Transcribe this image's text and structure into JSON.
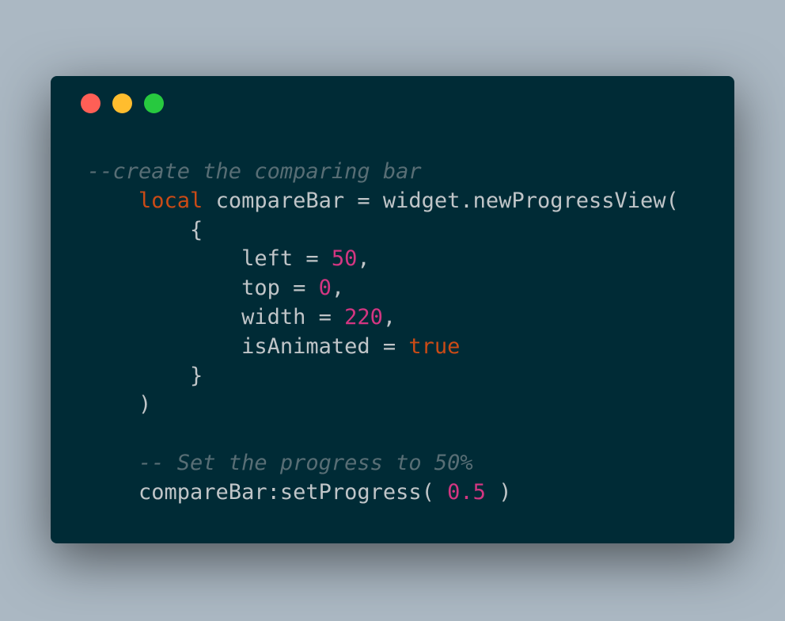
{
  "colors": {
    "background": "#abb8c3",
    "window": "#002b36",
    "text": "#c0c5c8",
    "comment": "#586e75",
    "keyword": "#cb4b16",
    "number": "#d33682",
    "close": "#ff5f56",
    "minimize": "#ffbd2e",
    "maximize": "#27c93f"
  },
  "window_controls": [
    {
      "name": "close-dot",
      "color": "#ff5f56"
    },
    {
      "name": "minimize-dot",
      "color": "#ffbd2e"
    },
    {
      "name": "maximize-dot",
      "color": "#27c93f"
    }
  ],
  "code_lines": [
    [
      {
        "t": "--create the comparing bar",
        "k": "comment"
      }
    ],
    [
      {
        "t": "    ",
        "k": "plain"
      },
      {
        "t": "local",
        "k": "keyword"
      },
      {
        "t": " compareBar = widget.newProgressView(",
        "k": "plain"
      }
    ],
    [
      {
        "t": "        {",
        "k": "plain"
      }
    ],
    [
      {
        "t": "            left = ",
        "k": "plain"
      },
      {
        "t": "50",
        "k": "number"
      },
      {
        "t": ",",
        "k": "plain"
      }
    ],
    [
      {
        "t": "            top = ",
        "k": "plain"
      },
      {
        "t": "0",
        "k": "number"
      },
      {
        "t": ",",
        "k": "plain"
      }
    ],
    [
      {
        "t": "            width = ",
        "k": "plain"
      },
      {
        "t": "220",
        "k": "number"
      },
      {
        "t": ",",
        "k": "plain"
      }
    ],
    [
      {
        "t": "            isAnimated = ",
        "k": "plain"
      },
      {
        "t": "true",
        "k": "keyword"
      }
    ],
    [
      {
        "t": "        }",
        "k": "plain"
      }
    ],
    [
      {
        "t": "    )",
        "k": "plain"
      }
    ],
    [
      {
        "t": "",
        "k": "plain"
      }
    ],
    [
      {
        "t": "    ",
        "k": "plain"
      },
      {
        "t": "-- Set the progress to 50%",
        "k": "comment"
      }
    ],
    [
      {
        "t": "    compareBar:setProgress( ",
        "k": "plain"
      },
      {
        "t": "0.5",
        "k": "number"
      },
      {
        "t": " )",
        "k": "plain"
      }
    ]
  ]
}
